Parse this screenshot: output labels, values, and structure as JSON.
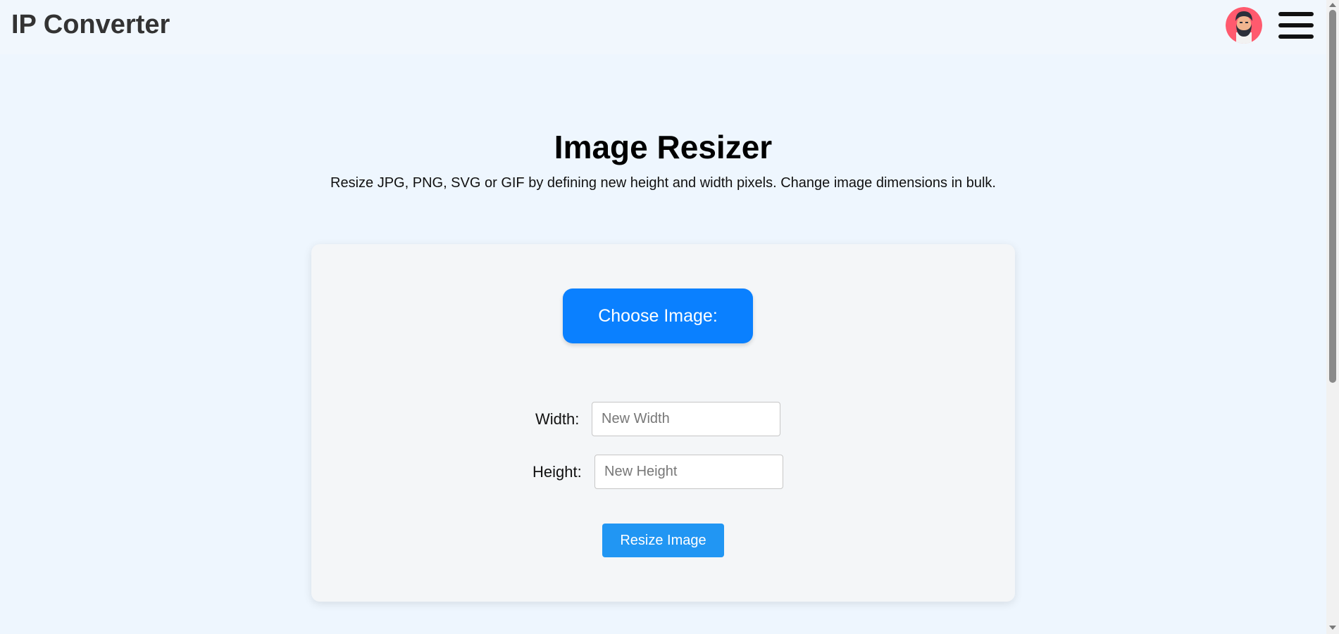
{
  "header": {
    "brand": "IP Converter",
    "avatar_icon": "bearded-man-avatar-icon",
    "menu_icon": "hamburger-menu-icon"
  },
  "main": {
    "title": "Image Resizer",
    "subtitle": "Resize JPG, PNG, SVG or GIF by defining new height and width pixels. Change image dimensions in bulk."
  },
  "form": {
    "choose_label": "Choose Image:",
    "width_label": "Width:",
    "width_placeholder": "New Width",
    "width_value": "",
    "height_label": "Height:",
    "height_placeholder": "New Height",
    "height_value": "",
    "submit_label": "Resize Image"
  },
  "colors": {
    "page_bg": "#eef6fe",
    "primary": "#0a80ff",
    "resize_button": "#2196f3",
    "avatar_bg": "#ff5a6e"
  }
}
